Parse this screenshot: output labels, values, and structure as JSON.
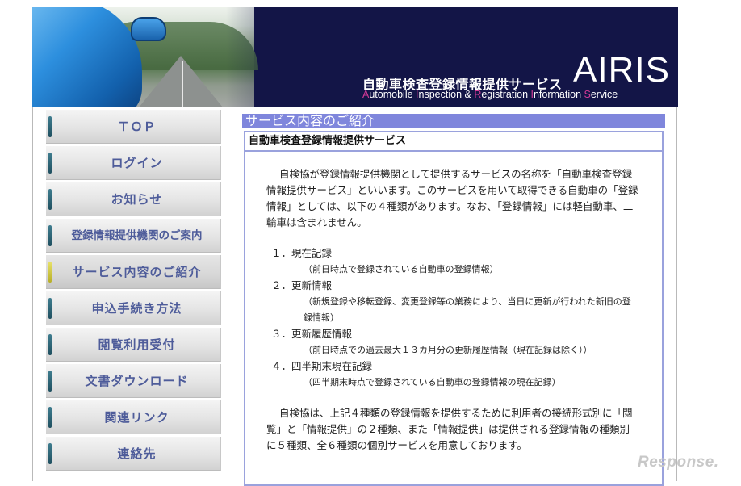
{
  "banner": {
    "title_jp": "自動車検査登録情報提供サービス",
    "logo": "AIRIS",
    "subtitle_en_parts": [
      {
        "text": "A",
        "highlight": true
      },
      {
        "text": "utomobile ",
        "highlight": false
      },
      {
        "text": "I",
        "highlight": true
      },
      {
        "text": "nspection & ",
        "highlight": false
      },
      {
        "text": "R",
        "highlight": true
      },
      {
        "text": "egistration ",
        "highlight": false
      },
      {
        "text": "I",
        "highlight": true
      },
      {
        "text": "nformation ",
        "highlight": false
      },
      {
        "text": "S",
        "highlight": true
      },
      {
        "text": "ervice",
        "highlight": false
      }
    ]
  },
  "nav": {
    "items": [
      {
        "label": "ＴＯＰ",
        "active": false
      },
      {
        "label": "ログイン",
        "active": false
      },
      {
        "label": "お知らせ",
        "active": false
      },
      {
        "label": "登録情報提供機関のご案内",
        "active": false
      },
      {
        "label": "サービス内容のご紹介",
        "active": true
      },
      {
        "label": "申込手続き方法",
        "active": false
      },
      {
        "label": "閲覧利用受付",
        "active": false
      },
      {
        "label": "文書ダウンロード",
        "active": false
      },
      {
        "label": "関連リンク",
        "active": false
      },
      {
        "label": "連絡先",
        "active": false
      }
    ]
  },
  "main": {
    "page_title": "サービス内容のご紹介",
    "section_title": "自動車検査登録情報提供サービス",
    "intro": "自検協が登録情報提供機関として提供するサービスの名称を「自動車検査登録情報提供サービス」といいます。このサービスを用いて取得できる自動車の「登録情報」としては、以下の４種類があります。なお、「登録情報」には軽自動車、二輪車は含まれません。",
    "list": [
      {
        "title": "１．現在記録",
        "note": "（前日時点で登録されている自動車の登録情報）"
      },
      {
        "title": "２．更新情報",
        "note": "（新規登録や移転登録、変更登録等の業務により、当日に更新が行われた新旧の登録情報）"
      },
      {
        "title": "３．更新履歴情報",
        "note": "（前日時点での過去最大１３カ月分の更新履歴情報（現在記録は除く））"
      },
      {
        "title": "４．四半期末現在記録",
        "note": "（四半期末時点で登録されている自動車の登録情報の現在記録）"
      }
    ],
    "closing": "自検協は、上記４種類の登録情報を提供するために利用者の接続形式別に「閲覧」と「情報提供」の２種類、また「情報提供」は提供される登録情報の種類別に５種類、全６種類の個別サービスを用意しております。"
  },
  "watermark": "Response."
}
